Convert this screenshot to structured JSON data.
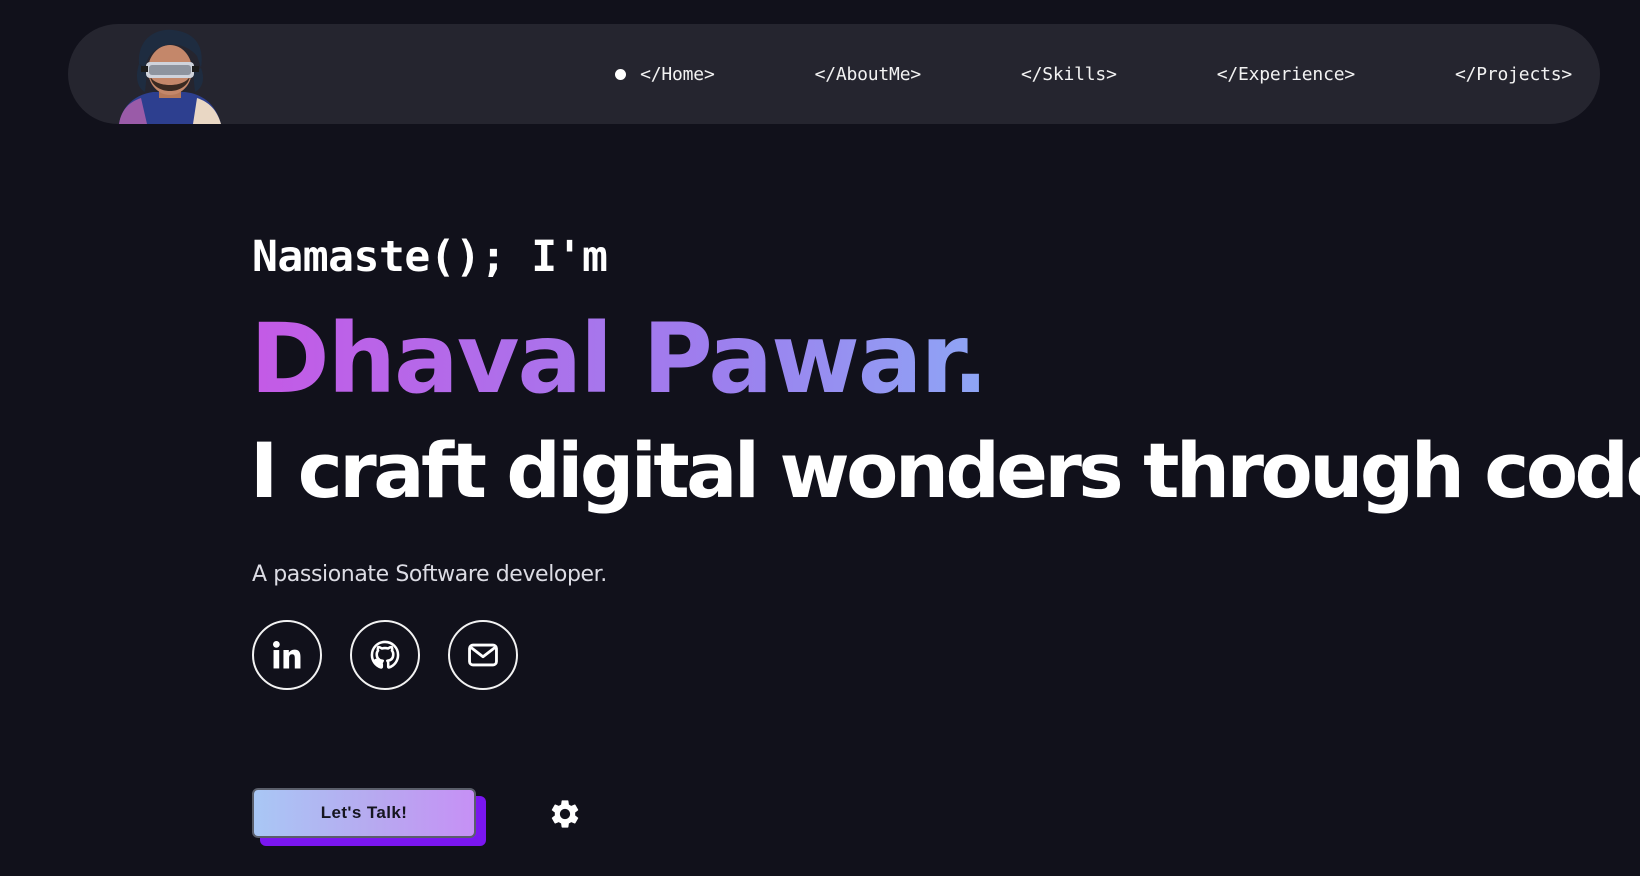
{
  "nav": {
    "links": [
      {
        "label": "</Home>",
        "active": true
      },
      {
        "label": "</AboutMe>",
        "active": false
      },
      {
        "label": "</Skills>",
        "active": false
      },
      {
        "label": "</Experience>",
        "active": false
      },
      {
        "label": "</Projects>",
        "active": false
      }
    ]
  },
  "hero": {
    "greeting": "Namaste(); I'm",
    "name": "Dhaval Pawar.",
    "tagline": "I craft digital wonders through code.",
    "subtitle": "A passionate Software developer."
  },
  "socials": [
    {
      "icon": "linkedin-icon"
    },
    {
      "icon": "github-icon"
    },
    {
      "icon": "mail-icon"
    }
  ],
  "cta": {
    "label": "Let's Talk!"
  },
  "settings": {
    "icon": "gear-icon"
  },
  "colors": {
    "background": "#11111b",
    "navbar": "#25252f",
    "name_gradient_start": "#c45ae6",
    "name_gradient_end": "#8ea6f5",
    "cta_shadow": "#7a16f0"
  }
}
